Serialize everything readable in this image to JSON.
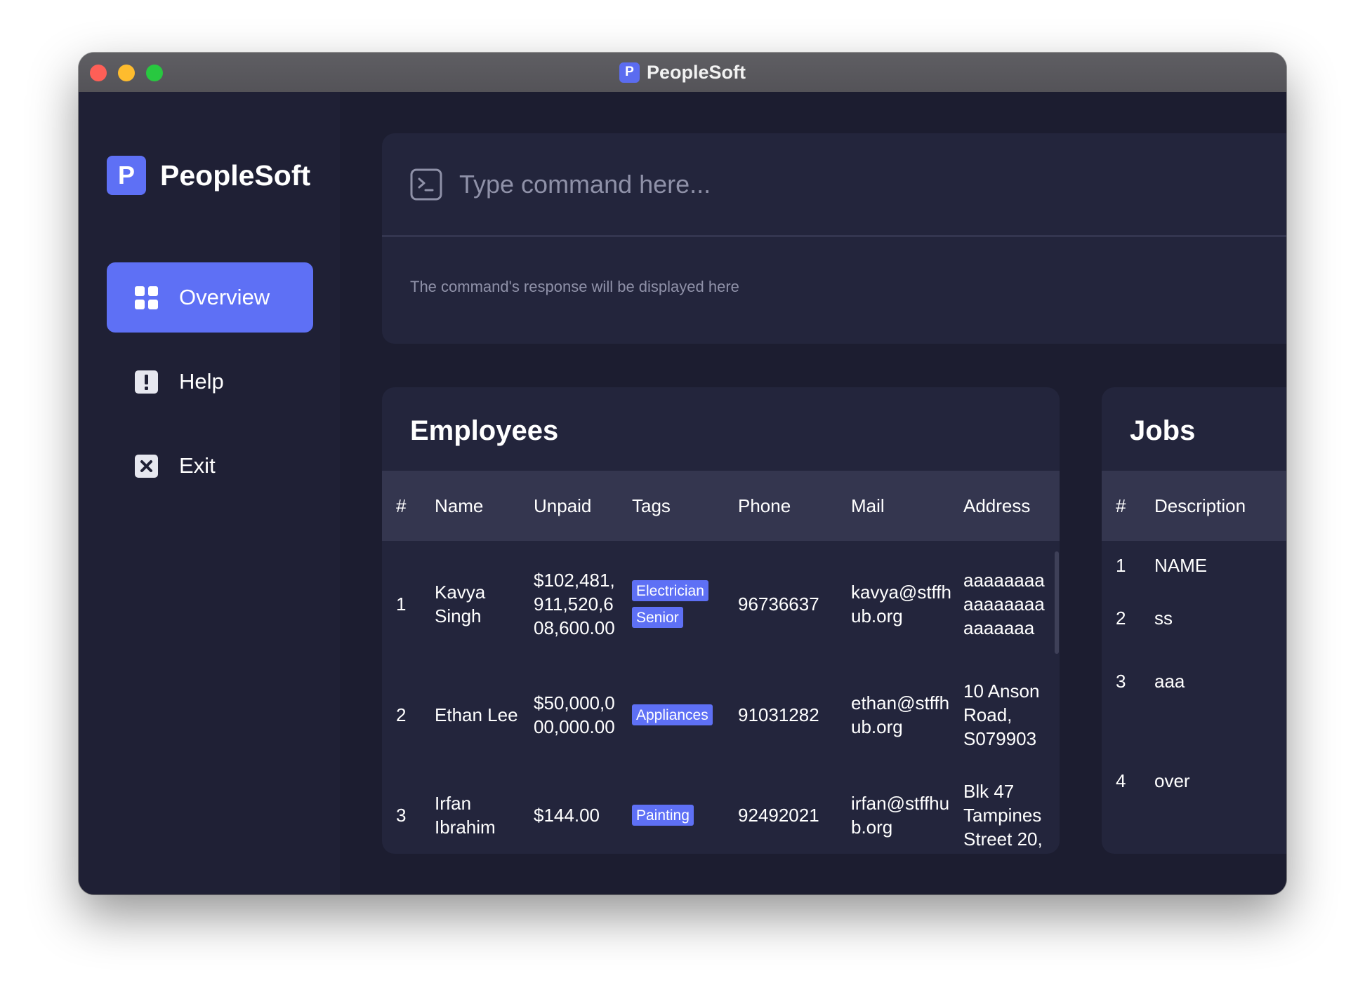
{
  "window": {
    "title": "PeopleSoft",
    "title_icon_letter": "P"
  },
  "sidebar": {
    "brand": {
      "icon_letter": "P",
      "name": "PeopleSoft"
    },
    "items": [
      {
        "label": "Overview",
        "icon": "grid-icon",
        "active": true
      },
      {
        "label": "Help",
        "icon": "exclamation-icon",
        "active": false
      },
      {
        "label": "Exit",
        "icon": "close-box-icon",
        "active": false
      }
    ]
  },
  "command": {
    "placeholder": "Type command here...",
    "value": "",
    "response": "The command's response will be displayed here"
  },
  "employees": {
    "title": "Employees",
    "columns": [
      "#",
      "Name",
      "Unpaid",
      "Tags",
      "Phone",
      "Mail",
      "Address"
    ],
    "rows": [
      {
        "index": "1",
        "name": "Kavya Singh",
        "unpaid": "$102,481,911,520,608,600.00",
        "tags": [
          "Electrician",
          "Senior"
        ],
        "phone": "96736637",
        "mail": "kavya@stffhub.org",
        "address": "aaaaaaaaaaaaaaaaaaaaaaa"
      },
      {
        "index": "2",
        "name": "Ethan Lee",
        "unpaid": "$50,000,000,000.00",
        "tags": [
          "Appliances"
        ],
        "phone": "91031282",
        "mail": "ethan@stffhub.org",
        "address": "10 Anson Road, S079903"
      },
      {
        "index": "3",
        "name": "Irfan Ibrahim",
        "unpaid": "$144.00",
        "tags": [
          "Painting"
        ],
        "phone": "92492021",
        "mail": "irfan@stffhub.org",
        "address": "Blk 47 Tampines Street 20,"
      }
    ]
  },
  "jobs": {
    "title": "Jobs",
    "columns": [
      "#",
      "Description"
    ],
    "rows": [
      {
        "index": "1",
        "description": "NAME"
      },
      {
        "index": "2",
        "description": "ss"
      },
      {
        "index": "3",
        "description": "aaa"
      },
      {
        "index": "4",
        "description": "over"
      }
    ]
  },
  "colors": {
    "accent": "#5e70f5",
    "background": "#1c1d30",
    "sidebar": "#1f2035",
    "panel": "#23253c",
    "table_header": "#34364f",
    "muted_text": "#8f91a8"
  }
}
